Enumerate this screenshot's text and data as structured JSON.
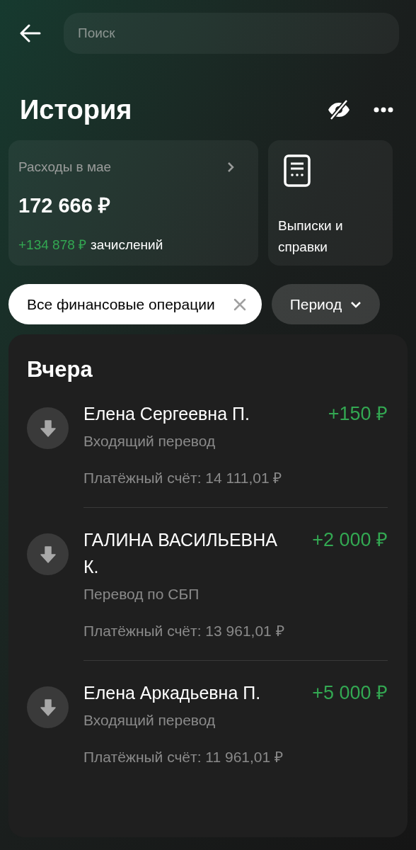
{
  "search": {
    "placeholder": "Поиск"
  },
  "title": "История",
  "spending_card": {
    "label": "Расходы в мае",
    "amount": "172 666 ₽",
    "income_amount": "+134 878 ₽",
    "income_label": "зачислений"
  },
  "statements_card": {
    "label": "Выписки и справки"
  },
  "filters": [
    {
      "label": "Все финансовые операции",
      "selected": true
    },
    {
      "label": "Период",
      "selected": false
    }
  ],
  "section": {
    "title": "Вчера",
    "transactions": [
      {
        "name": "Елена Сергеевна П.",
        "amount": "+150 ₽",
        "type": "Входящий перевод",
        "account": "Платёжный счёт: 14 111,01 ₽"
      },
      {
        "name": "ГАЛИНА ВАСИЛЬЕВНА К.",
        "amount": "+2 000 ₽",
        "type": "Перевод по СБП",
        "account": "Платёжный счёт: 13 961,01 ₽"
      },
      {
        "name": "Елена Аркадьевна П.",
        "amount": "+5 000 ₽",
        "type": "Входящий перевод",
        "account": "Платёжный счёт: 11 961,01 ₽"
      }
    ]
  }
}
